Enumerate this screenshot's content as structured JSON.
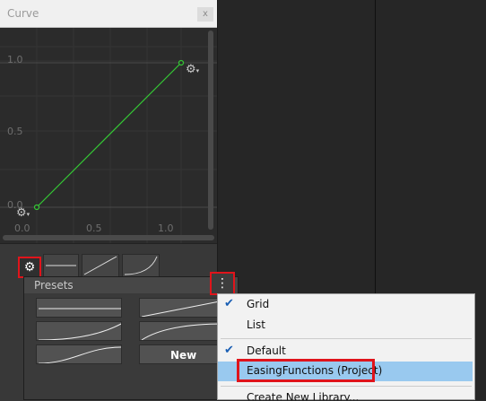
{
  "window": {
    "title": "Curve",
    "close_label": "x"
  },
  "graph": {
    "y_labels": [
      "1.0",
      "0.5",
      "0.0"
    ],
    "x_labels": [
      "0.0",
      "0.5",
      "1.0"
    ],
    "curve_color": "#34c934",
    "gear_icon": "gear-icon"
  },
  "presets": {
    "title": "Presets",
    "new_label": "New"
  },
  "context_menu": {
    "grid": "Grid",
    "list": "List",
    "default": "Default",
    "easing": "EasingFunctions (Project)",
    "create": "Create New Library..."
  },
  "colors": {
    "highlight": "#e0141b",
    "selected": "#99c9ef",
    "check": "#1a5fb4"
  }
}
